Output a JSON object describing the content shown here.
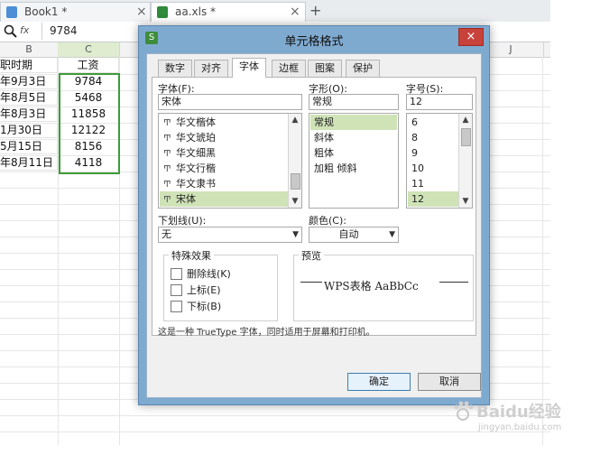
{
  "tabs": {
    "file1": "Book1 *",
    "file2": "aa.xls *",
    "new_tab": "+"
  },
  "formula_bar": {
    "fx": "fx",
    "value": "9784"
  },
  "sheet": {
    "col_b": "B",
    "col_c": "C",
    "col_j": "J",
    "header_b": "职时期",
    "header_c": "工资",
    "rows": [
      {
        "b": "年9月3日",
        "c": "9784"
      },
      {
        "b": "年8月5日",
        "c": "5468"
      },
      {
        "b": "年8月3日",
        "c": "11858"
      },
      {
        "b": "1月30日",
        "c": "12122"
      },
      {
        "b": "5月15日",
        "c": "8156"
      },
      {
        "b": "年8月11日",
        "c": "4118"
      }
    ]
  },
  "dialog": {
    "title": "单元格格式",
    "close": "×",
    "icon": "S",
    "tabs": [
      "数字",
      "对齐",
      "字体",
      "边框",
      "图案",
      "保护"
    ],
    "active_tab": "字体",
    "font_label": "字体(F):",
    "font_value": "宋体",
    "font_list": [
      "华文楷体",
      "华文琥珀",
      "华文细黑",
      "华文行楷",
      "华文隶书",
      "宋体"
    ],
    "style_label": "字形(O):",
    "style_value": "常规",
    "style_list": [
      "常规",
      "斜体",
      "粗体",
      "加粗 倾斜"
    ],
    "size_label": "字号(S):",
    "size_value": "12",
    "size_list": [
      "6",
      "8",
      "9",
      "10",
      "11",
      "12"
    ],
    "underline_label": "下划线(U):",
    "underline_value": "无",
    "color_label": "颜色(C):",
    "color_value": "自动",
    "effects_title": "特殊效果",
    "effects": [
      "删除线(K)",
      "上标(E)",
      "下标(B)"
    ],
    "preview_title": "预览",
    "preview_text": "WPS表格  AaBbCc",
    "description": "这是一种 TrueType 字体，同时适用于屏幕和打印机。",
    "ok": "确定",
    "cancel": "取消"
  },
  "watermark": {
    "brand": "Baidu经验",
    "url": "jingyan.baidu.com"
  }
}
